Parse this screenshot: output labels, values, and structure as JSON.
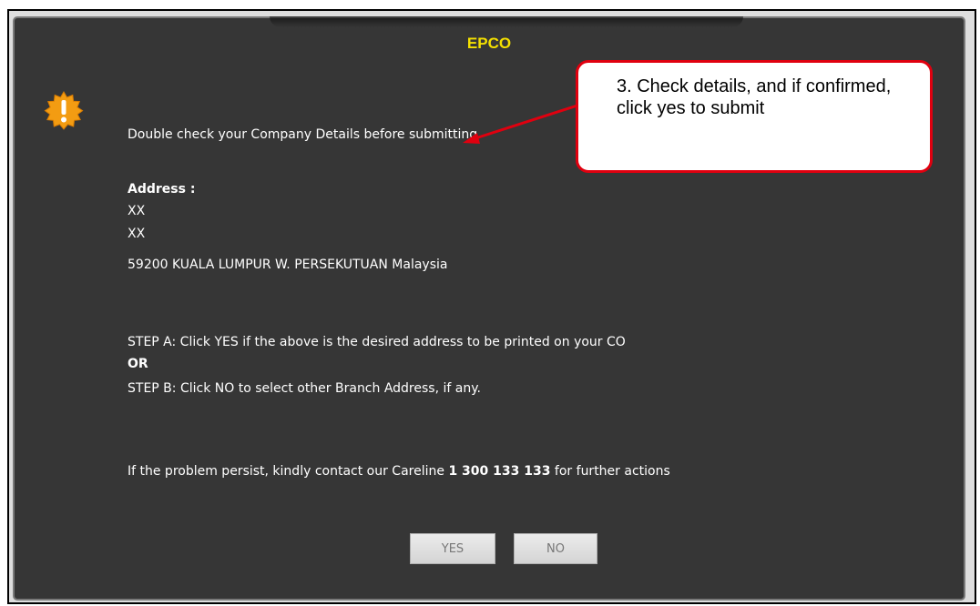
{
  "dialog": {
    "title": "EPCO",
    "icon": "warning-burst-icon",
    "message": {
      "intro": "Double check your Company Details before submitting",
      "address_label": "Address :",
      "address_lines": [
        "XX",
        "XX",
        "59200 KUALA LUMPUR W. PERSEKUTUAN Malaysia"
      ],
      "step_a": "STEP A: Click YES if the above is the desired address to be printed on your CO",
      "or_label": "OR",
      "step_b": "STEP B: Click NO to select other Branch Address, if any.",
      "contact_prefix": "If the problem persist, kindly contact our Careline ",
      "contact_number": "1 300 133 133",
      "contact_suffix": " for further actions"
    },
    "buttons": {
      "yes": "YES",
      "no": "NO"
    }
  },
  "annotation": {
    "text": "3. Check details, and if confirmed, click yes to submit"
  },
  "colors": {
    "dialog_bg": "#363636",
    "title": "#f4e000",
    "callout_border": "#e0000f",
    "icon_fill": "#f39c12"
  }
}
